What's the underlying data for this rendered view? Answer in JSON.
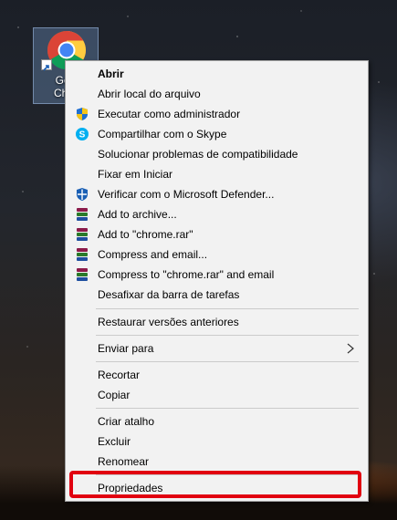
{
  "desktop": {
    "icon_label_line1": "Goo",
    "icon_label_line2": "Chro",
    "icon": "chrome-icon"
  },
  "menu": {
    "items": [
      {
        "label": "Abrir",
        "icon": null
      },
      {
        "label": "Abrir local do arquivo",
        "icon": null
      },
      {
        "label": "Executar como administrador",
        "icon": "shield-icon"
      },
      {
        "label": "Compartilhar com o Skype",
        "icon": "skype-icon"
      },
      {
        "label": "Solucionar problemas de compatibilidade",
        "icon": null
      },
      {
        "label": "Fixar em Iniciar",
        "icon": null
      },
      {
        "label": "Verificar com o Microsoft Defender...",
        "icon": "defender-icon"
      },
      {
        "label": "Add to archive...",
        "icon": "winrar-icon"
      },
      {
        "label": "Add to \"chrome.rar\"",
        "icon": "winrar-icon"
      },
      {
        "label": "Compress and email...",
        "icon": "winrar-icon"
      },
      {
        "label": "Compress to \"chrome.rar\" and email",
        "icon": "winrar-icon"
      },
      {
        "label": "Desafixar da barra de tarefas",
        "icon": null
      },
      {
        "label": "Restaurar versões anteriores",
        "icon": null
      },
      {
        "label": "Enviar para",
        "icon": null,
        "submenu": true
      },
      {
        "label": "Recortar",
        "icon": null
      },
      {
        "label": "Copiar",
        "icon": null
      },
      {
        "label": "Criar atalho",
        "icon": null
      },
      {
        "label": "Excluir",
        "icon": null
      },
      {
        "label": "Renomear",
        "icon": null
      },
      {
        "label": "Propriedades",
        "icon": null,
        "highlighted": true
      }
    ]
  },
  "colors": {
    "highlight_border": "#e10010",
    "menu_background": "#f2f2f2"
  }
}
